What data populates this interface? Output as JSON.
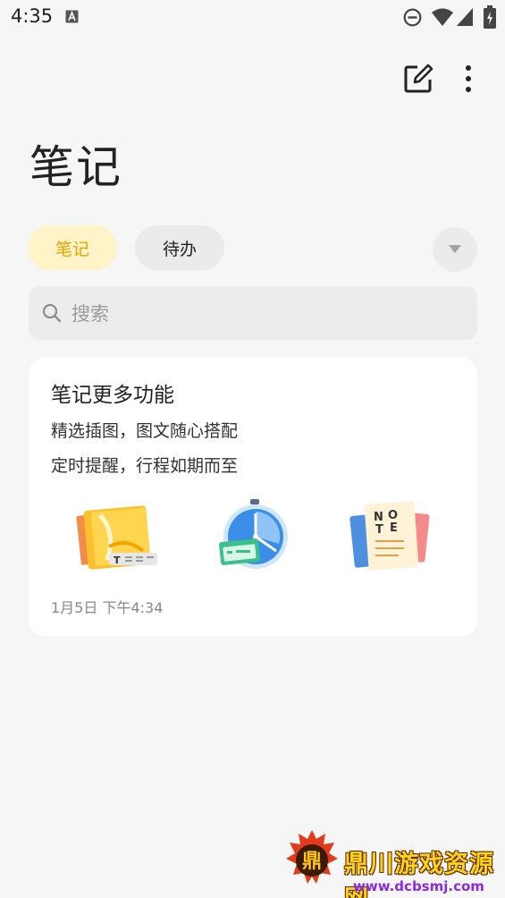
{
  "status_bar": {
    "time": "4:35",
    "icons": [
      "a-icon",
      "dnd-icon",
      "wifi-icon",
      "signal-icon",
      "battery-icon"
    ]
  },
  "toolbar": {
    "edit_icon": "edit-icon",
    "more_icon": "more-vert-icon"
  },
  "page_title": "笔记",
  "tabs": [
    {
      "label": "笔记",
      "selected": true
    },
    {
      "label": "待办",
      "selected": false
    }
  ],
  "dropdown_icon": "triangle-down-icon",
  "search": {
    "placeholder": "搜索"
  },
  "note_card": {
    "title": "笔记更多功能",
    "lines": [
      "精选插图，图文随心搭配",
      "定时提醒，行程如期而至"
    ],
    "illustrations": [
      "note-yellow-icon",
      "clock-icon",
      "notepad-icon"
    ],
    "date": "1月5日  下午4:34"
  },
  "watermark": {
    "title": "鼎川游戏资源网",
    "url": "www.dcbsmj.com"
  },
  "colors": {
    "accent_yellow": "#e8a300",
    "tab_selected_bg": "#fff3c8",
    "background": "#f6f6f6"
  }
}
